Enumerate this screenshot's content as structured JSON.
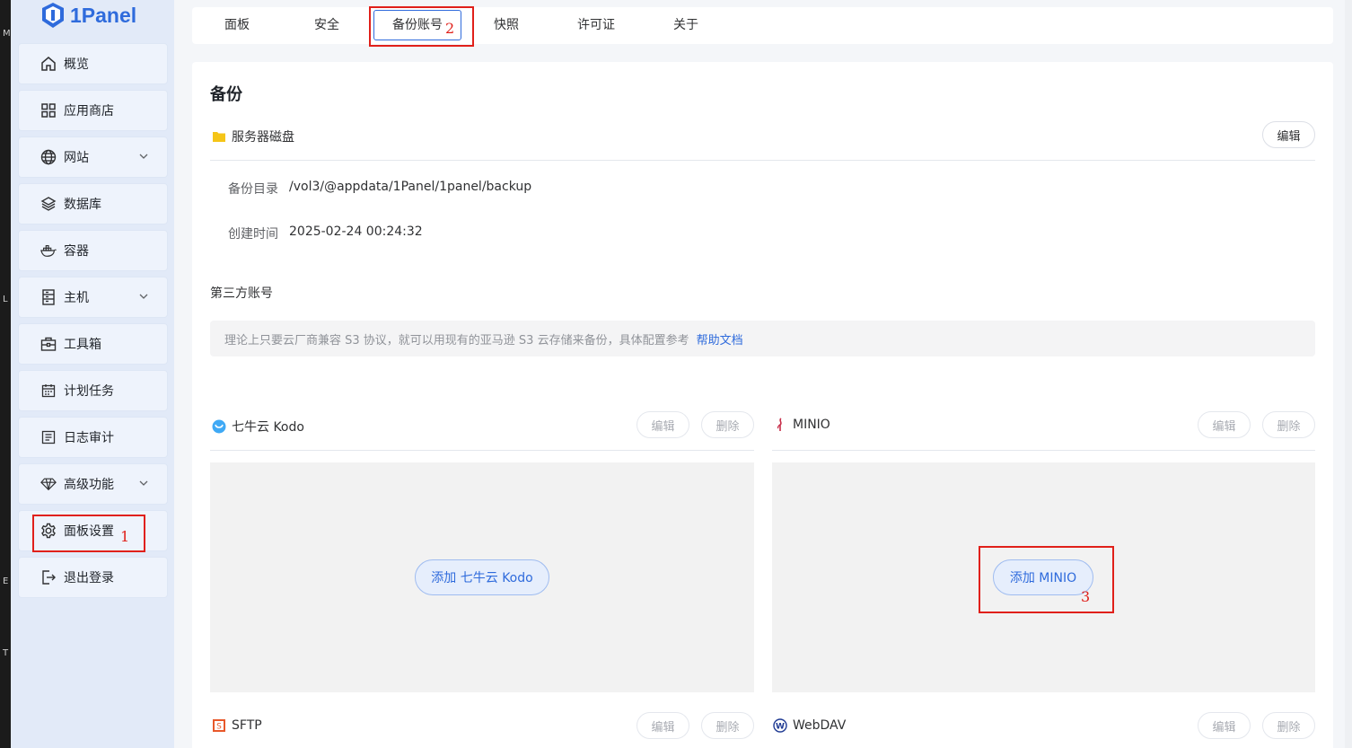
{
  "brand": {
    "name": "1Panel"
  },
  "left_strip": [
    "M",
    "L",
    "E",
    "T"
  ],
  "sidebar": {
    "items": [
      {
        "label": "概览",
        "icon": "home-icon"
      },
      {
        "label": "应用商店",
        "icon": "apps-icon"
      },
      {
        "label": "网站",
        "icon": "globe-icon",
        "expandable": true
      },
      {
        "label": "数据库",
        "icon": "layers-icon"
      },
      {
        "label": "容器",
        "icon": "docker-icon"
      },
      {
        "label": "主机",
        "icon": "server-icon",
        "expandable": true
      },
      {
        "label": "工具箱",
        "icon": "toolbox-icon"
      },
      {
        "label": "计划任务",
        "icon": "calendar-icon"
      },
      {
        "label": "日志审计",
        "icon": "log-icon"
      },
      {
        "label": "高级功能",
        "icon": "diamond-icon",
        "expandable": true
      },
      {
        "label": "面板设置",
        "icon": "gear-icon"
      },
      {
        "label": "退出登录",
        "icon": "logout-icon"
      }
    ]
  },
  "tabs": [
    {
      "label": "面板"
    },
    {
      "label": "安全"
    },
    {
      "label": "备份账号",
      "active": true
    },
    {
      "label": "快照"
    },
    {
      "label": "许可证"
    },
    {
      "label": "关于"
    }
  ],
  "annotations": {
    "one": "1",
    "two": "2",
    "three": "3"
  },
  "backup": {
    "title": "备份",
    "server_disk": {
      "name": "服务器磁盘",
      "edit_label": "编辑",
      "dir_label": "备份目录",
      "dir_value": "/vol3/@appdata/1Panel/1panel/backup",
      "created_label": "创建时间",
      "created_value": "2025-02-24 00:24:32"
    },
    "third_party_title": "第三方账号",
    "notice_text": "理论上只要云厂商兼容 S3 协议，就可以用现有的亚马逊 S3 云存储来备份，具体配置参考",
    "help_link": "帮助文档",
    "services": [
      {
        "name": "七牛云 Kodo",
        "edit": "编辑",
        "delete": "删除",
        "add": "添加 七牛云 Kodo"
      },
      {
        "name": "MINIO",
        "edit": "编辑",
        "delete": "删除",
        "add": "添加 MINIO"
      },
      {
        "name": "SFTP",
        "edit": "编辑",
        "delete": "删除"
      },
      {
        "name": "WebDAV",
        "edit": "编辑",
        "delete": "删除"
      }
    ]
  },
  "colors": {
    "accent": "#2f6bdc",
    "annotation": "#e0201a",
    "sidebar_bg": "#e2eaf8"
  }
}
